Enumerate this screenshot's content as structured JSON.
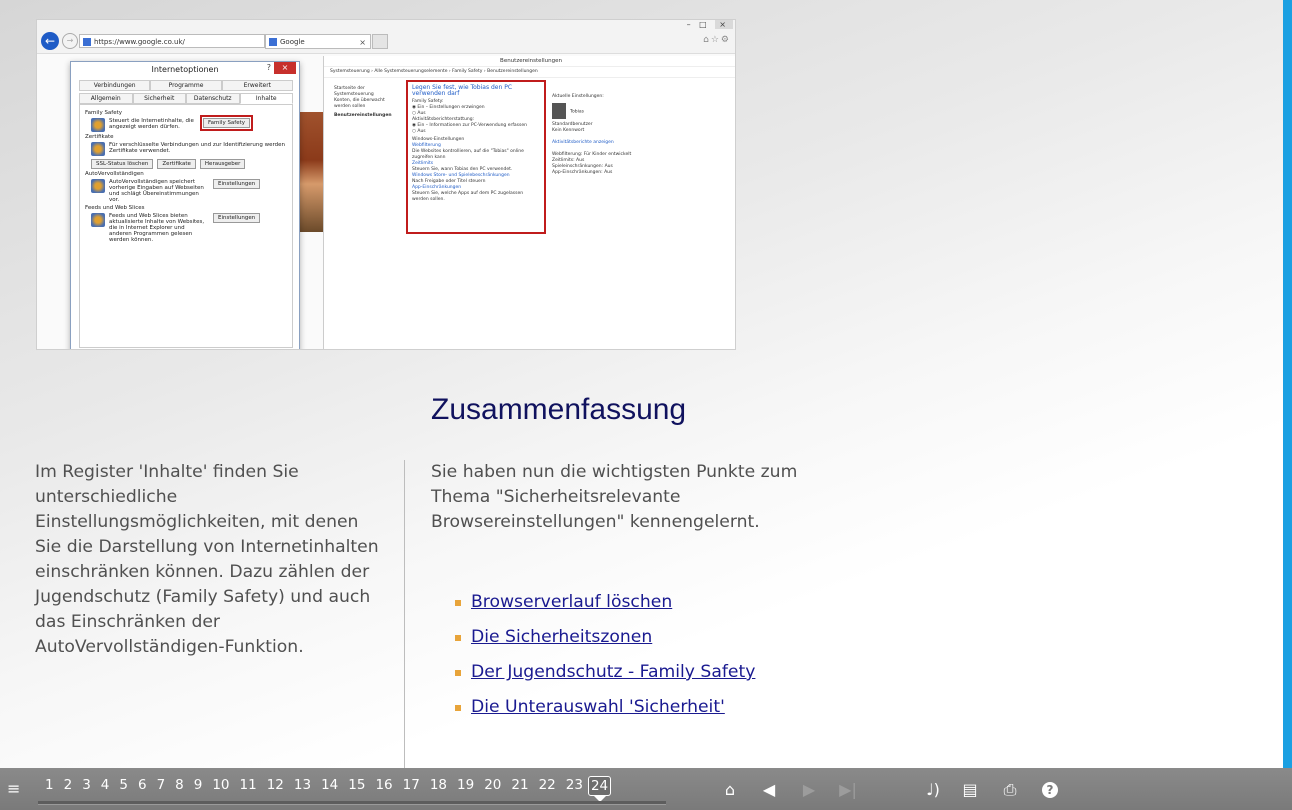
{
  "screenshot": {
    "address": "https://www.google.co.uk/",
    "tab_title": "Google",
    "dialog": {
      "title": "Internetoptionen",
      "tabs_row1": [
        "Verbindungen",
        "Programme",
        "Erweitert"
      ],
      "tabs_row2": [
        "Allgemein",
        "Sicherheit",
        "Datenschutz",
        "Inhalte"
      ],
      "family_safety_heading": "Family Safety",
      "family_safety_text": "Steuert die Internetinhalte, die angezeigt werden dürfen.",
      "family_safety_button": "Family Safety",
      "certificates_heading": "Zertifikate",
      "certificates_text": "Für verschlüsselte Verbindungen und zur Identifizierung werden Zertifikate verwendet.",
      "ssl_button": "SSL-Status löschen",
      "cert_button": "Zertifikate",
      "publisher_button": "Herausgeber",
      "autocomplete_heading": "AutoVervollständigen",
      "autocomplete_text": "AutoVervollständigen speichert vorherige Eingaben auf Webseiten und schlägt Übereinstimmungen vor.",
      "settings_button": "Einstellungen",
      "feeds_heading": "Feeds und Web Slices",
      "feeds_text": "Feeds und Web Slices bieten aktualisierte Inhalte von Websites, die in Internet Explorer und anderen Programmen gelesen werden können.",
      "feeds_button": "Einstellungen"
    },
    "user_settings": {
      "title": "Benutzereinstellungen",
      "breadcrumb": "Systemsteuerung › Alle Systemsteuerungselemente › Family Safety › Benutzereinstellungen",
      "left_links": [
        "Startseite der Systemsteuerung",
        "Konten, die überwacht werden sollen"
      ],
      "left_active": "Benutzereinstellungen",
      "box_heading": "Legen Sie fest, wie Tobias den PC verwenden darf",
      "fs_label": "Family Safety:",
      "fs_on": "Ein – Einstellungen erzwingen",
      "fs_off": "Aus",
      "activity_label": "Aktivitätsberichterstattung:",
      "activity_on": "Ein – Informationen zur PC-Verwendung erfassen",
      "activity_off": "Aus",
      "windows_label": "Windows-Einstellungen",
      "web_link": "Webfilterung",
      "web_text": "Die Websites kontrollieren, auf die \"Tobias\" online zugreifen kann",
      "time_link": "Zeitlimits",
      "time_text": "Steuern Sie, wann Tobias den PC verwendet.",
      "store_link": "Windows Store- und Spielebeschränkungen",
      "store_text": "Nach Freigabe oder Titel steuern",
      "app_link": "App-Einschränkungen",
      "app_text": "Steuern Sie, welche Apps auf dem PC zugelassen werden sollen.",
      "current_label": "Aktuelle Einstellungen:",
      "user_name": "Tobias",
      "user_role": "Standardbenutzer",
      "user_pw": "Kein Kennwort",
      "report_link": "Aktivitätsberichte anzeigen",
      "web_status": "Webfilterung: Für Kinder entwickelt",
      "time_status": "Zeitlimits: Aus",
      "game_status": "Spieleinschränkungen: Aus",
      "app_status": "App-Einschränkungen: Aus"
    }
  },
  "content": {
    "heading": "Zusammenfassung",
    "left_paragraph": "Im Register 'Inhalte' finden Sie unterschiedliche Einstellungsmöglichkeiten, mit denen Sie die Darstellung von Internetinhalten einschränken können. Dazu zählen der Jugendschutz (Family Safety) und auch das Einschränken der AutoVervollständigen-Funktion.",
    "right_paragraph": "Sie haben nun die wichtigsten Punkte zum Thema \"Sicherheitsrelevante Browsereinstellungen\" kennengelernt.",
    "links": [
      "Browserverlauf löschen",
      "Die Sicherheitszonen",
      "Der Jugendschutz - Family Safety",
      "Die Unterauswahl 'Sicherheit'"
    ]
  },
  "nav": {
    "pages": [
      "1",
      "2",
      "3",
      "4",
      "5",
      "6",
      "7",
      "8",
      "9",
      "10",
      "11",
      "12",
      "13",
      "14",
      "15",
      "16",
      "17",
      "18",
      "19",
      "20",
      "21",
      "22",
      "23",
      "24"
    ],
    "current_page": "24",
    "icons": [
      "menu-icon",
      "home-icon",
      "back-icon",
      "forward-icon",
      "last-icon",
      "volume-icon",
      "bookmark-add-icon",
      "print-icon",
      "help-icon"
    ]
  },
  "colors": {
    "accent_stripe": "#1ba0e2",
    "heading": "#10125e",
    "link": "#1a1a90",
    "bullet": "#e8a43a",
    "navbar": "#7f7f7f"
  }
}
